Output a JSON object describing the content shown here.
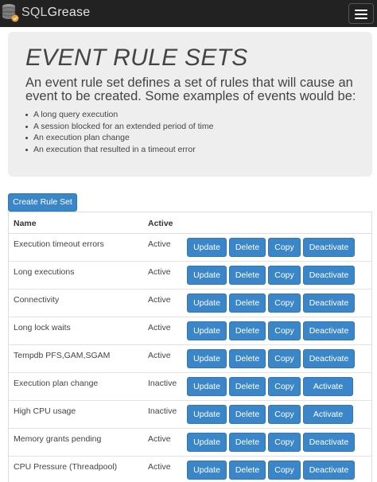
{
  "navbar": {
    "brand_prefix": "SQL",
    "brand_suffix": "Grease"
  },
  "jumbotron": {
    "title": "EVENT RULE SETS",
    "lead": "An event rule set defines a set of rules that will cause an event to be created. Some examples of events would be:",
    "examples": [
      "A long query execution",
      "A session blocked for an extended period of time",
      "An execution plan change",
      "An execution that resulted in a timeout error"
    ]
  },
  "create_button_label": "Create Rule Set",
  "table": {
    "headers": {
      "name": "Name",
      "active": "Active"
    },
    "button_labels": {
      "update": "Update",
      "delete": "Delete",
      "copy": "Copy",
      "deactivate": "Deactivate",
      "activate": "Activate"
    },
    "rows": [
      {
        "name": "Execution timeout errors",
        "active": "Active",
        "toggle": "Deactivate"
      },
      {
        "name": "Long executions",
        "active": "Active",
        "toggle": "Deactivate"
      },
      {
        "name": "Connectivity",
        "active": "Active",
        "toggle": "Deactivate"
      },
      {
        "name": "Long lock waits",
        "active": "Active",
        "toggle": "Deactivate"
      },
      {
        "name": "Tempdb PFS,GAM,SGAM",
        "active": "Active",
        "toggle": "Deactivate"
      },
      {
        "name": "Execution plan change",
        "active": "Inactive",
        "toggle": "Activate"
      },
      {
        "name": "High CPU usage",
        "active": "Inactive",
        "toggle": "Activate"
      },
      {
        "name": "Memory grants pending",
        "active": "Active",
        "toggle": "Deactivate"
      },
      {
        "name": "CPU Pressure (Threadpool)",
        "active": "Active",
        "toggle": "Deactivate"
      }
    ]
  },
  "colors": {
    "navbar_bg": "#222222",
    "button_primary": "#3a86c8",
    "jumbotron_bg": "#eeeeee"
  }
}
